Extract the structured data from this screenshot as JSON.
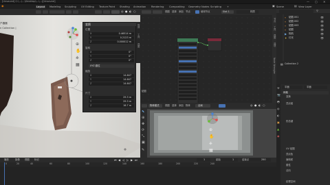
{
  "title_bar": {
    "path": "[Unsaved] C:\\...\\...\\Desktop\\...\\...\\[Unsaved]",
    "minimize": "—",
    "maximize": "▢",
    "close": "✕"
  },
  "menu": {
    "items": [
      "Layout",
      "Modeling",
      "Sculpting",
      "UV Editing",
      "Texture Paint",
      "Shading",
      "Animation",
      "Rendering",
      "Compositing",
      "Geometry Nodes",
      "Scripting",
      "+"
    ],
    "active_index": 0,
    "scene_label": "Scene",
    "view_layer_label": "View Layer"
  },
  "viewport": {
    "collection_fragments": [
      "户器器",
      "n Collection |"
    ],
    "side_tabs": [
      "物体",
      "工具",
      "视图"
    ]
  },
  "npanel": {
    "header": "变换",
    "location_label": "位置",
    "location": [
      {
        "axis": "X",
        "value": "0.46514 m"
      },
      {
        "axis": "Y",
        "value": "0.2123 m"
      },
      {
        "axis": "Z",
        "value": "0.000012 m"
      }
    ],
    "rotation_label": "旋转",
    "rotation": [
      {
        "axis": "X",
        "value": "0°"
      },
      {
        "axis": "Y",
        "value": "0°"
      },
      {
        "axis": "Z",
        "value": "0°"
      }
    ],
    "mode_label": "XYZ 欧拉",
    "scale_label": "缩放",
    "scale": [
      {
        "axis": "X",
        "value": "14.647"
      },
      {
        "axis": "Y",
        "value": "14.647"
      },
      {
        "axis": "Z",
        "value": "14.647"
      }
    ],
    "dimensions_label": "尺寸",
    "dimensions": [
      {
        "axis": "X",
        "value": "29.3 m"
      },
      {
        "axis": "Y",
        "value": "29.3 m"
      },
      {
        "axis": "Z",
        "value": "18.7 m"
      }
    ]
  },
  "node_editor": {
    "header_items": [
      "物体",
      "视图",
      "选择",
      "添加",
      "节点"
    ],
    "use_nodes_label": "使用节点",
    "slot_label": "Slot 1",
    "material_label": "材质",
    "side_tabs": [
      "节点",
      "工具",
      "视图",
      "选项",
      "Node Wrangler"
    ],
    "frame_label": "贴图"
  },
  "render_view": {
    "mode_label": "物体模式",
    "menus": [
      "视图",
      "选择",
      "添加",
      "物体"
    ],
    "shading_label": "全局"
  },
  "outliner": {
    "items": [
      {
        "label": "贴图.001",
        "color": "#c8843a"
      },
      {
        "label": "贴图.002",
        "color": "#c8843a"
      },
      {
        "label": "贴图.003",
        "color": "#c8843a"
      },
      {
        "label": "贴图",
        "color": "#c8843a"
      },
      {
        "label": "相机",
        "color": "#6fa8dc"
      },
      {
        "label": "灯光",
        "color": "#e6c040"
      },
      {
        "label": "Collection 2",
        "color": "#d2d2d2"
      }
    ]
  },
  "properties": {
    "tabs": [
      "平面",
      "平面"
    ],
    "sections": [
      "网格",
      "变换",
      "形态键",
      "UV 贴图",
      "顶点色",
      "面映射",
      "属性",
      "法向",
      "纹理空间"
    ],
    "rows": [
      "变换",
      "顶点组",
      "形态键",
      "UV 贴图",
      "顶点色",
      "面映射",
      "属性"
    ]
  },
  "timeline": {
    "menus": [
      "播放",
      "抠像",
      "视图",
      "标记"
    ],
    "frame_ticks": [
      "0",
      "20",
      "40",
      "60",
      "80",
      "100",
      "120",
      "140",
      "160",
      "180",
      "200",
      "220",
      "240"
    ],
    "current_frame": "1",
    "start_label": "起始",
    "start": "1",
    "end_label": "结束点",
    "end": "250"
  },
  "colors": {
    "accent": "#3e6ec9",
    "x_axis": "#e24d4d",
    "y_axis": "#6bbd38",
    "z_axis": "#4a85d6"
  }
}
